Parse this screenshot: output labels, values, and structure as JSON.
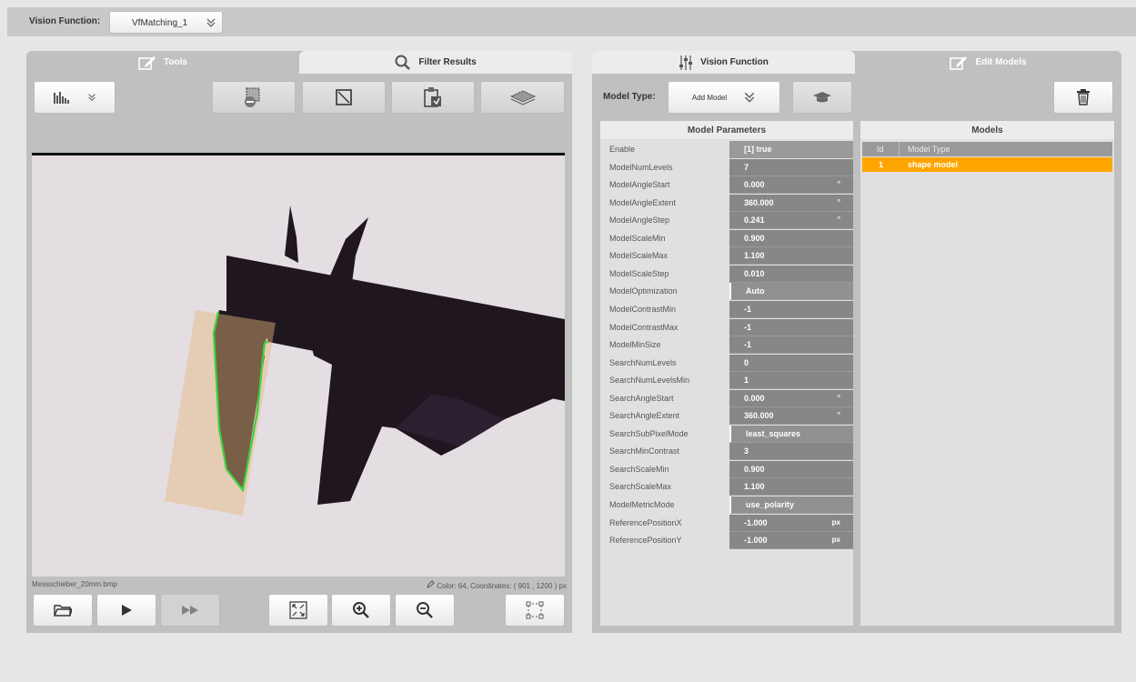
{
  "topbar": {
    "label": "Vision Function:",
    "selected": "VfMatching_1"
  },
  "left": {
    "tabs": {
      "tools": "Tools",
      "filter": "Filter Results"
    },
    "filename": "Messschieber_20mm.bmp",
    "status": "Color:   64, Coordinates: (  901 , 1200 ) px"
  },
  "right": {
    "tabs": {
      "vision": "Vision Function",
      "edit": "Edit Models"
    },
    "model_type_label": "Model Type:",
    "model_type_value": "Add Model",
    "params_title": "Model Parameters",
    "models_title": "Models",
    "models_cols": {
      "id": "Id",
      "type": "Model Type"
    },
    "models_rows": [
      {
        "id": "1",
        "type": "shape model"
      }
    ],
    "params": [
      {
        "name": "Enable",
        "value": "[1] true",
        "unit": ""
      },
      {
        "name": "ModelNumLevels",
        "value": "7",
        "unit": ""
      },
      {
        "name": "ModelAngleStart",
        "value": "0.000",
        "unit": "°"
      },
      {
        "name": "ModelAngleExtent",
        "value": "360.000",
        "unit": "°"
      },
      {
        "name": "ModelAngleStep",
        "value": "0.241",
        "unit": "°"
      },
      {
        "name": "ModelScaleMin",
        "value": "0.900",
        "unit": ""
      },
      {
        "name": "ModelScaleMax",
        "value": "1.100",
        "unit": ""
      },
      {
        "name": "ModelScaleStep",
        "value": "0.010",
        "unit": ""
      },
      {
        "name": "ModelOptimization",
        "value": "Auto",
        "unit": ""
      },
      {
        "name": "ModelContrastMin",
        "value": "-1",
        "unit": ""
      },
      {
        "name": "ModelContrastMax",
        "value": "-1",
        "unit": ""
      },
      {
        "name": "ModelMinSize",
        "value": "-1",
        "unit": ""
      },
      {
        "name": "SearchNumLevels",
        "value": "0",
        "unit": ""
      },
      {
        "name": "SearchNumLevelsMin",
        "value": "1",
        "unit": ""
      },
      {
        "name": "SearchAngleStart",
        "value": "0.000",
        "unit": "°"
      },
      {
        "name": "SearchAngleExtent",
        "value": "360.000",
        "unit": "°"
      },
      {
        "name": "SearchSubPixelMode",
        "value": "least_squares",
        "unit": ""
      },
      {
        "name": "SearchMinContrast",
        "value": "3",
        "unit": ""
      },
      {
        "name": "SearchScaleMin",
        "value": "0.900",
        "unit": ""
      },
      {
        "name": "SearchScaleMax",
        "value": "1.100",
        "unit": ""
      },
      {
        "name": "ModelMetricMode",
        "value": "use_polarity",
        "unit": ""
      },
      {
        "name": "ReferencePositionX",
        "value": "-1.000",
        "unit": "px"
      },
      {
        "name": "ReferencePositionY",
        "value": "-1.000",
        "unit": "px"
      }
    ]
  },
  "colors": {
    "accent": "#ffa500",
    "panel": "#c0c0c0",
    "value_cell": "#878787"
  }
}
